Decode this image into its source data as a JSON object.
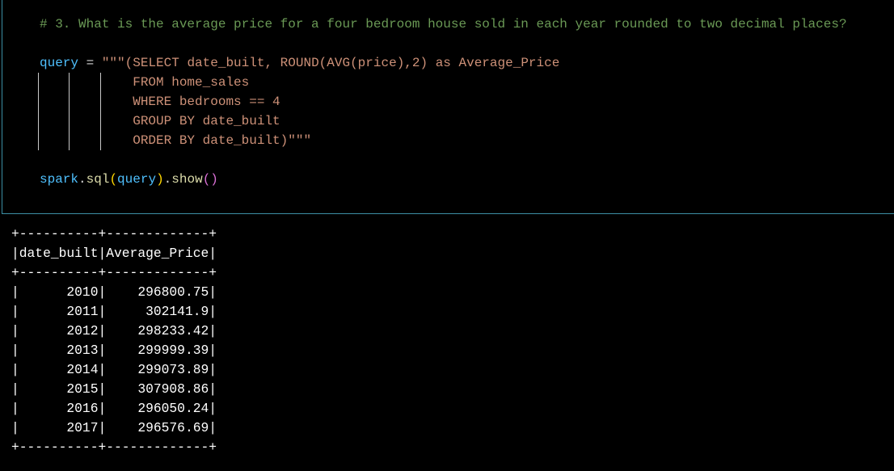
{
  "code_cell": {
    "comment": "# 3. What is the average price for a four bedroom house sold in each year rounded to two decimal places?",
    "query_var": "query",
    "assign": " = ",
    "sql_line1": "\"\"\"(SELECT date_built, ROUND(AVG(price),2) as Average_Price",
    "sql_line2": "FROM home_sales",
    "sql_line3": "WHERE bedrooms == 4",
    "sql_line4": "GROUP BY date_built",
    "sql_line5": "ORDER BY date_built)\"\"\"",
    "spark": "spark",
    "dot1": ".",
    "sql_fn": "sql",
    "open_paren": "(",
    "arg": "query",
    "close_paren": ")",
    "dot2": ".",
    "show_fn": "show",
    "empty_parens": "()"
  },
  "output": {
    "border": "+----------+-------------+",
    "header": "|date_built|Average_Price|",
    "rows": [
      "|      2010|    296800.75|",
      "|      2011|     302141.9|",
      "|      2012|    298233.42|",
      "|      2013|    299999.39|",
      "|      2014|    299073.89|",
      "|      2015|    307908.86|",
      "|      2016|    296050.24|",
      "|      2017|    296576.69|"
    ],
    "columns": [
      "date_built",
      "Average_Price"
    ],
    "table": [
      [
        "2010",
        "296800.75"
      ],
      [
        "2011",
        "302141.9"
      ],
      [
        "2012",
        "298233.42"
      ],
      [
        "2013",
        "299999.39"
      ],
      [
        "2014",
        "299073.89"
      ],
      [
        "2015",
        "307908.86"
      ],
      [
        "2016",
        "296050.24"
      ],
      [
        "2017",
        "296576.69"
      ]
    ]
  },
  "colors": {
    "background": "#000000",
    "cell_border": "#3c8fa5",
    "comment": "#6a9955",
    "variable": "#4fc1ff",
    "string": "#ce9178",
    "function": "#dcdcaa",
    "output_text": "#ffffff"
  }
}
